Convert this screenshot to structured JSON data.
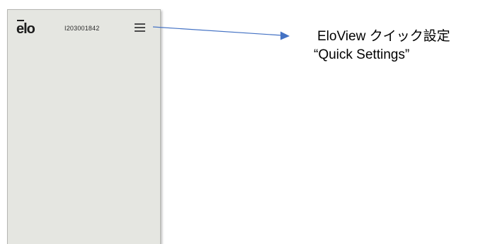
{
  "device": {
    "logo_text": "elo",
    "serial_number": "I203001842",
    "menu_icon": "hamburger-menu-icon",
    "panel_color": "#e5e6e1"
  },
  "annotation": {
    "title": "EloView クイック設定",
    "subtitle": "“Quick Settings”",
    "arrow_color": "#4472c4"
  }
}
